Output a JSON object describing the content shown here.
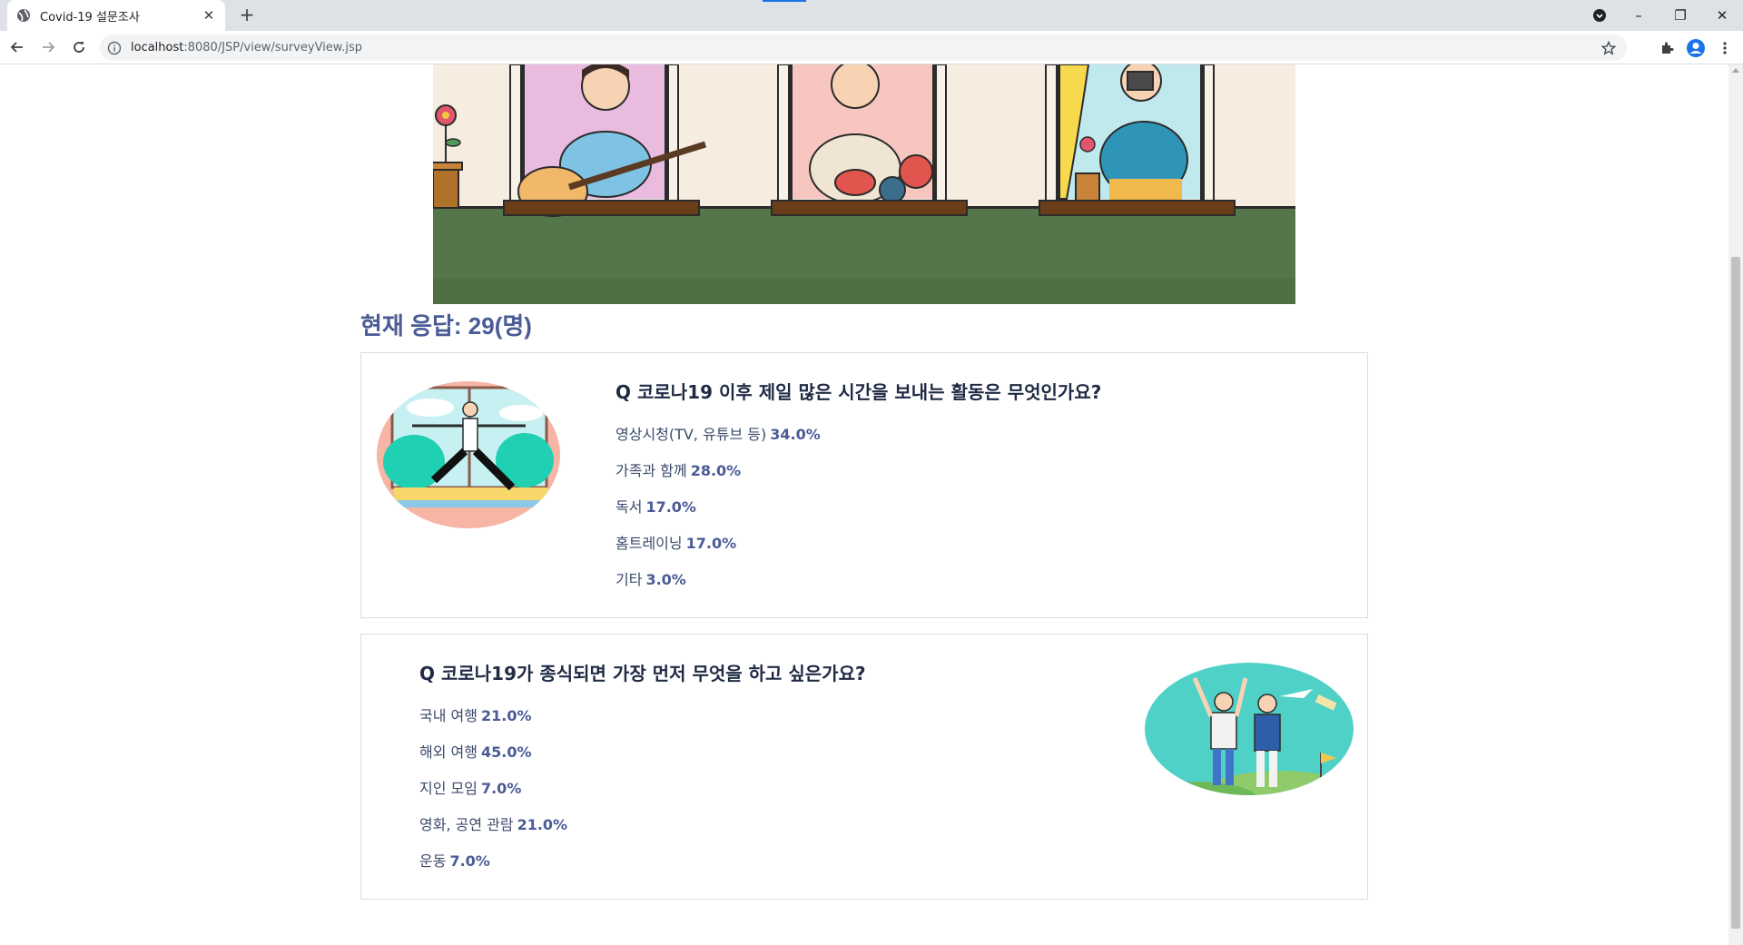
{
  "browser": {
    "tab_title": "Covid-19 설문조사",
    "tab_close": "✕",
    "new_tab": "+",
    "url_host": "localhost",
    "url_path": ":8080/JSP/view/surveyView.jsp",
    "window_controls": [
      "–",
      "❐",
      "✕"
    ]
  },
  "page": {
    "response_count_label": "현재 응답: 29(명)"
  },
  "questions": [
    {
      "title": "Q 코로나19 이후 제일 많은 시간을 보내는 활동은 무엇인가요?",
      "options": [
        {
          "label": "영상시청(TV, 유튜브 등)",
          "pct": "34.0%"
        },
        {
          "label": "가족과 함께",
          "pct": "28.0%"
        },
        {
          "label": "독서",
          "pct": "17.0%"
        },
        {
          "label": "홈트레이닝",
          "pct": "17.0%"
        },
        {
          "label": "기타",
          "pct": "3.0%"
        }
      ],
      "illustration": "yoga-illustration"
    },
    {
      "title": "Q 코로나19가 종식되면 가장 먼저 무엇을 하고 싶은가요?",
      "options": [
        {
          "label": "국내 여행",
          "pct": "21.0%"
        },
        {
          "label": "해외 여행",
          "pct": "45.0%"
        },
        {
          "label": "지인 모임",
          "pct": "7.0%"
        },
        {
          "label": "영화, 공연 관람",
          "pct": "21.0%"
        },
        {
          "label": "운동",
          "pct": "7.0%"
        }
      ],
      "illustration": "travel-illustration"
    }
  ],
  "icons": {
    "favicon": "globe-icon",
    "back": "arrow-left-icon",
    "forward": "arrow-right-icon",
    "reload": "reload-icon",
    "info": "info-icon",
    "bookmark": "star-icon",
    "extensions": "puzzle-icon",
    "profile": "avatar-icon",
    "menu": "kebab-menu-icon"
  },
  "colors": {
    "accent": "#4a5b96",
    "question_text": "#1f2a44",
    "card_border": "#dcdcdc",
    "hero_ground": "#55764a"
  }
}
